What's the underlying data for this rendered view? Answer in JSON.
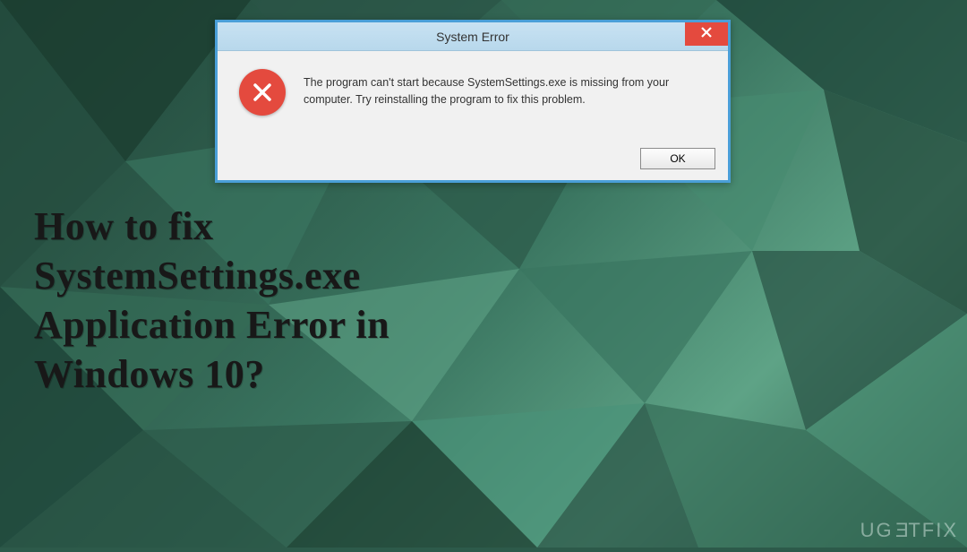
{
  "dialog": {
    "title": "System Error",
    "message": "The program can't start because SystemSettings.exe is missing from your computer. Try reinstalling the program to fix this problem.",
    "ok_label": "OK"
  },
  "headline": "How to fix\nSystemSettings.exe\nApplication Error in\nWindows 10?",
  "watermark": {
    "prefix": "UG",
    "flip": "E",
    "suffix": "TFIX"
  }
}
